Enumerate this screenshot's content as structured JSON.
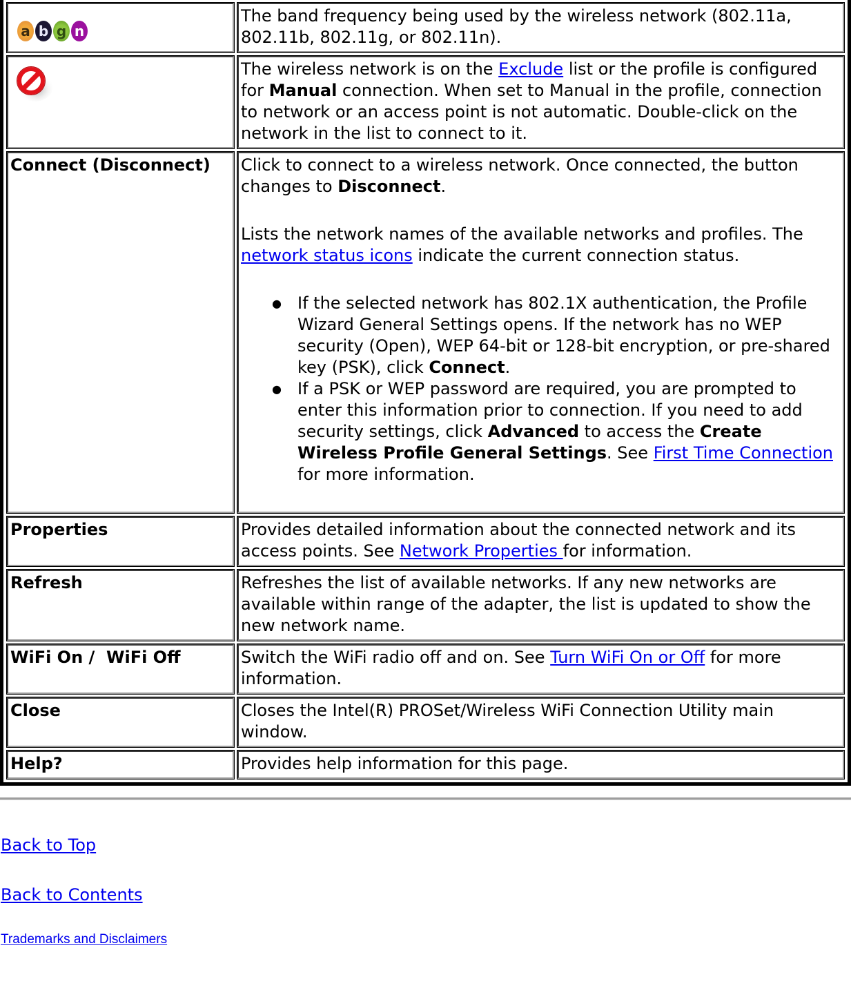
{
  "colors": {
    "link": "#0000ee",
    "border": "#000000"
  },
  "rows": [
    {
      "label_icon": "band-frequency-abgn-icon",
      "badges": [
        "a",
        "b",
        "g",
        "n"
      ],
      "desc": {
        "text": "The band frequency being used by the wireless network (802.11a, 802.11b, 802.11g, or 802.11n)."
      }
    },
    {
      "label_icon": "no-entry-excluded-icon",
      "desc": {
        "t1": "The wireless network is on the ",
        "link": "Exclude",
        "t2": " list or the profile is configured for ",
        "bold": "Manual",
        "t3": " connection. When set to Manual in the profile, connection to network or an access point is not automatic. Double-click on the network in the list to connect to it."
      }
    },
    {
      "label": "Connect (Disconnect)",
      "desc": {
        "p1_t1": "Click to connect to a wireless network. Once connected, the button changes to ",
        "p1_bold": "Disconnect",
        "p1_t2": ".",
        "p2_t1": "Lists the network names of the available networks and profiles. The ",
        "p2_link": "network status icons",
        "p2_t2": " indicate the current connection status.",
        "bullet1_t1": "If the selected network has 802.1X authentication, the Profile Wizard General Settings opens. If the network has no WEP security (Open), WEP 64-bit or 128-bit encryption, or pre-shared key (PSK), click ",
        "bullet1_bold": "Connect",
        "bullet1_t2": ".",
        "bullet2_t1": "If a PSK or WEP password are required, you are prompted to enter this information prior to connection. If you need to add security settings, click ",
        "bullet2_bold1": "Advanced",
        "bullet2_t2": " to access the ",
        "bullet2_bold2": "Create Wireless Profile General Settings",
        "bullet2_t3": ". See ",
        "bullet2_link": "First Time Connection ",
        "bullet2_t4": "for more information.",
        "bullet_glyph": "●"
      }
    },
    {
      "label": "Properties",
      "desc": {
        "t1": "Provides detailed information about the connected network and its access points. See ",
        "link": "Network Properties ",
        "t2": "for information."
      }
    },
    {
      "label": "Refresh",
      "desc": {
        "text": "Refreshes the list of available networks. If any new networks are available within range of the adapter, the list is updated to show the new network name."
      }
    },
    {
      "label": "WiFi On /  WiFi Off",
      "desc": {
        "t1": "Switch the WiFi radio off and on. See ",
        "link": "Turn WiFi On or Off",
        "t2": " for more information."
      }
    },
    {
      "label": "Close",
      "desc": {
        "text": "Closes the Intel(R) PROSet/Wireless WiFi Connection Utility main window."
      }
    },
    {
      "label": "Help?",
      "desc": {
        "text": "Provides help information for this page."
      }
    }
  ],
  "footer": {
    "back_to_top": "Back to Top",
    "back_to_contents": "Back to Contents",
    "trademarks": "Trademarks and Disclaimers"
  }
}
